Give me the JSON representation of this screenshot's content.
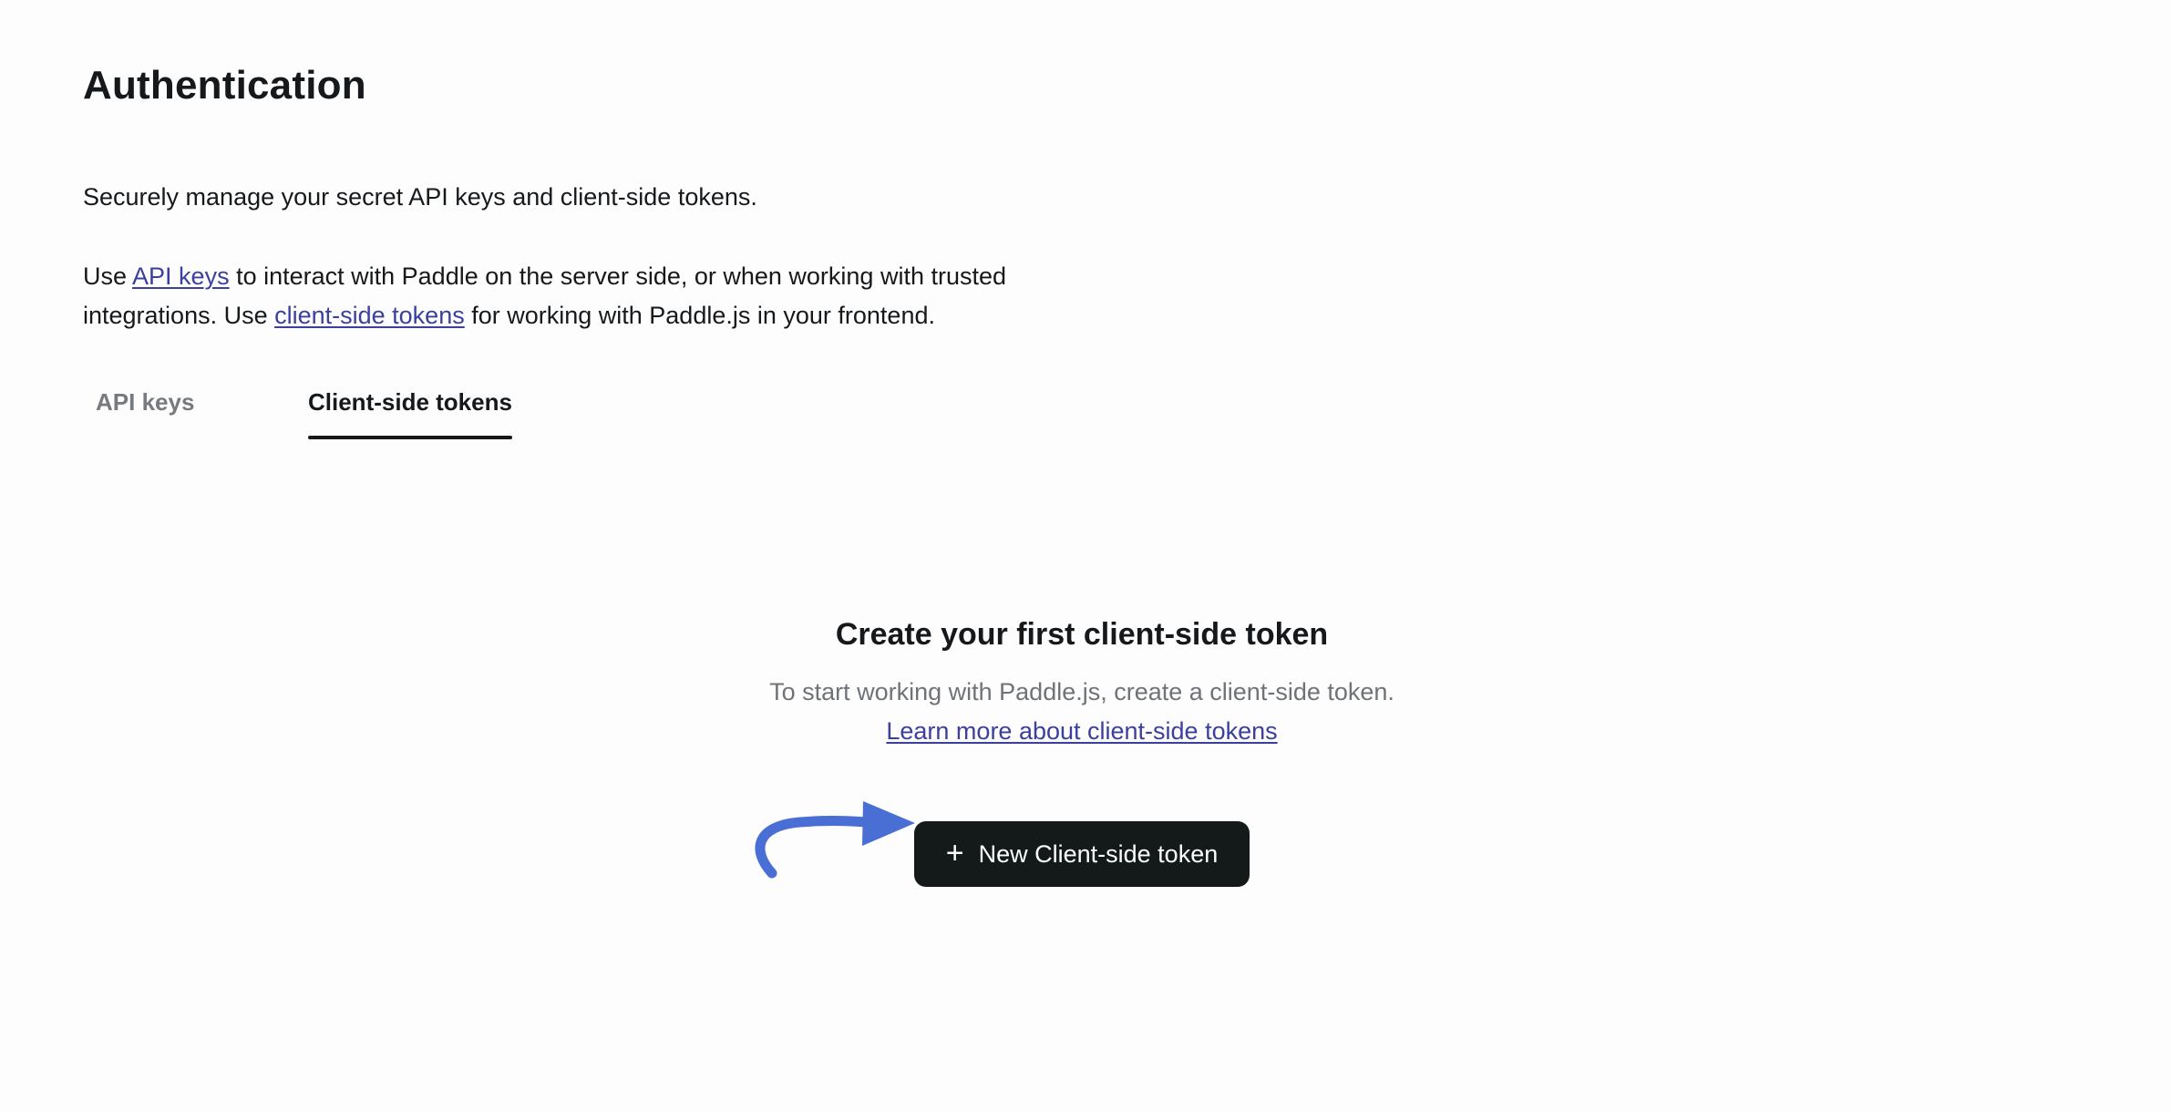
{
  "page": {
    "title": "Authentication",
    "intro": "Securely manage your secret API keys and client-side tokens.",
    "description": {
      "part1": "Use ",
      "api_keys_link": "API keys",
      "part2": " to interact with Paddle on the server side, or when working with trusted integrations. Use ",
      "client_tokens_link": "client-side tokens",
      "part3": " for working with Paddle.js in your frontend."
    }
  },
  "tabs": [
    {
      "label": "API keys",
      "active": false
    },
    {
      "label": "Client-side tokens",
      "active": true
    }
  ],
  "empty_state": {
    "title": "Create your first client-side token",
    "text": "To start working with Paddle.js, create a client-side token.",
    "learn_more": "Learn more about client-side tokens",
    "button_label": "New Client-side token",
    "button_icon": "plus-icon"
  },
  "colors": {
    "link": "#3a3fa0",
    "button_bg": "#141a1a",
    "arrow": "#4a6fd4",
    "muted_text": "#6f7378"
  },
  "annotation": {
    "icon": "curved-arrow-icon"
  }
}
